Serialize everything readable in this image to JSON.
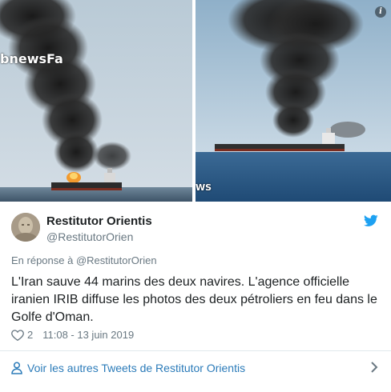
{
  "media": {
    "left_watermark": "bnewsFa",
    "right_watermark": "WS",
    "info_icon": "info-icon"
  },
  "tweet": {
    "display_name": "Restitutor Orientis",
    "handle": "@RestitutorOrien",
    "reply_to": "En réponse à @RestitutorOrien",
    "text": "L'Iran sauve 44 marins des deux navires. L'agence officielle iranien IRIB diffuse les photos des deux pétroliers en feu dans le Golfe d'Oman.",
    "like_count": "2",
    "timestamp": "11:08 - 13 juin 2019"
  },
  "footer": {
    "more_tweets": "Voir les autres Tweets de Restitutor Orientis"
  },
  "colors": {
    "link": "#2b7bb9",
    "twitter_blue": "#1da1f2",
    "secondary_text": "#697882"
  }
}
